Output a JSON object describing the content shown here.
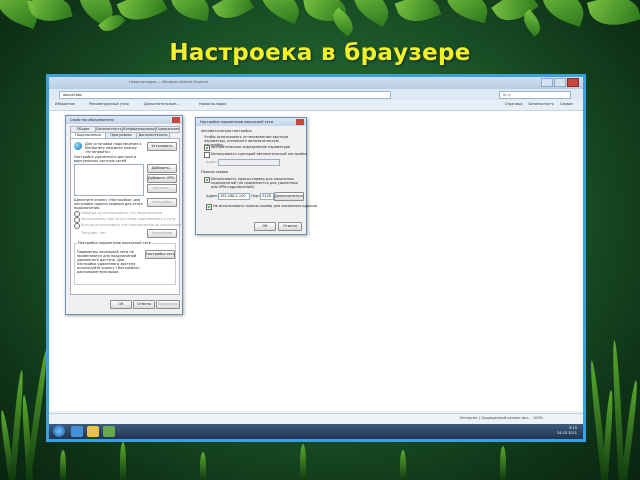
{
  "slide": {
    "title": "Настроека в браузере"
  },
  "browser": {
    "window_title": "Новая вкладка — Windows Internet Explorer",
    "address": "about:tabs",
    "search_placeholder": "Bing",
    "favorites": "Избранное",
    "fav_items": [
      "Рекомендуемые узлы",
      "Дополнительные..."
    ],
    "tab": "Новая вкладка",
    "commands": [
      "Страница",
      "Безопасность",
      "Сервис"
    ],
    "status": "Интернет | Защищенный режим: вкл.",
    "zoom": "100%",
    "clock": {
      "time": "9:15",
      "date": "24.03.2011"
    }
  },
  "props_dialog": {
    "title": "Свойства обозревателя",
    "tabs_row1": [
      "Общие",
      "Безопасность",
      "Конфиденциальность",
      "Содержание"
    ],
    "tabs_row2": [
      "Подключения",
      "Программы",
      "Дополнительно"
    ],
    "setup_text": "Для установки подключения к Интернету нажмите кнопку «Установить».",
    "setup_button": "Установить",
    "dialup_label": "Настройка удаленного доступа и виртуальных частных сетей",
    "add_button": "Добавить...",
    "add_vpn_button": "Добавить VPN...",
    "remove_button": "Удалить...",
    "settings_text": "Щелкните кнопку «Настройка» для настройки прокси-сервера для этого подключения.",
    "settings_button": "Настройка",
    "radio_never": "Никогда не использовать это подключение",
    "radio_no_network": "Использовать при отсутствии подключения к сети",
    "radio_always": "Всегда использовать это подключение по умолчанию",
    "current_label": "Текущее",
    "not_set": "Нет",
    "default_button": "Умолчание",
    "lan_title": "Настройка параметров локальной сети",
    "lan_text": "Параметры локальной сети не применяются для подключений удаленного доступа. Для настройки удаленного доступа используйте кнопку «Настройка», расположенную выше.",
    "lan_button": "Настройка сети",
    "ok": "ОК",
    "cancel": "Отмена",
    "apply": "Применить"
  },
  "lan_dialog": {
    "title": "Настройка параметров локальной сети",
    "auto_group": "Автоматическая настройка",
    "auto_text": "Чтобы использовать установленные вручную параметры, отключите автоматическую настройку.",
    "auto_detect": "Автоматическое определение параметров",
    "use_script": "Использовать сценарий автоматической настройки",
    "address_label": "Адрес",
    "proxy_group": "Прокси-сервер",
    "use_proxy": "Использовать прокси-сервер для локальных подключений (не применяется для удаленных или VPN-подключений).",
    "addr_field_label": "Адрес:",
    "proxy_address": "192.168.1.100",
    "port_label": "Порт:",
    "proxy_port": "3128",
    "advanced_button": "Дополнительно",
    "bypass_local": "Не использовать прокси-сервер для локальных адресов",
    "ok": "ОК",
    "cancel": "Отмена"
  }
}
